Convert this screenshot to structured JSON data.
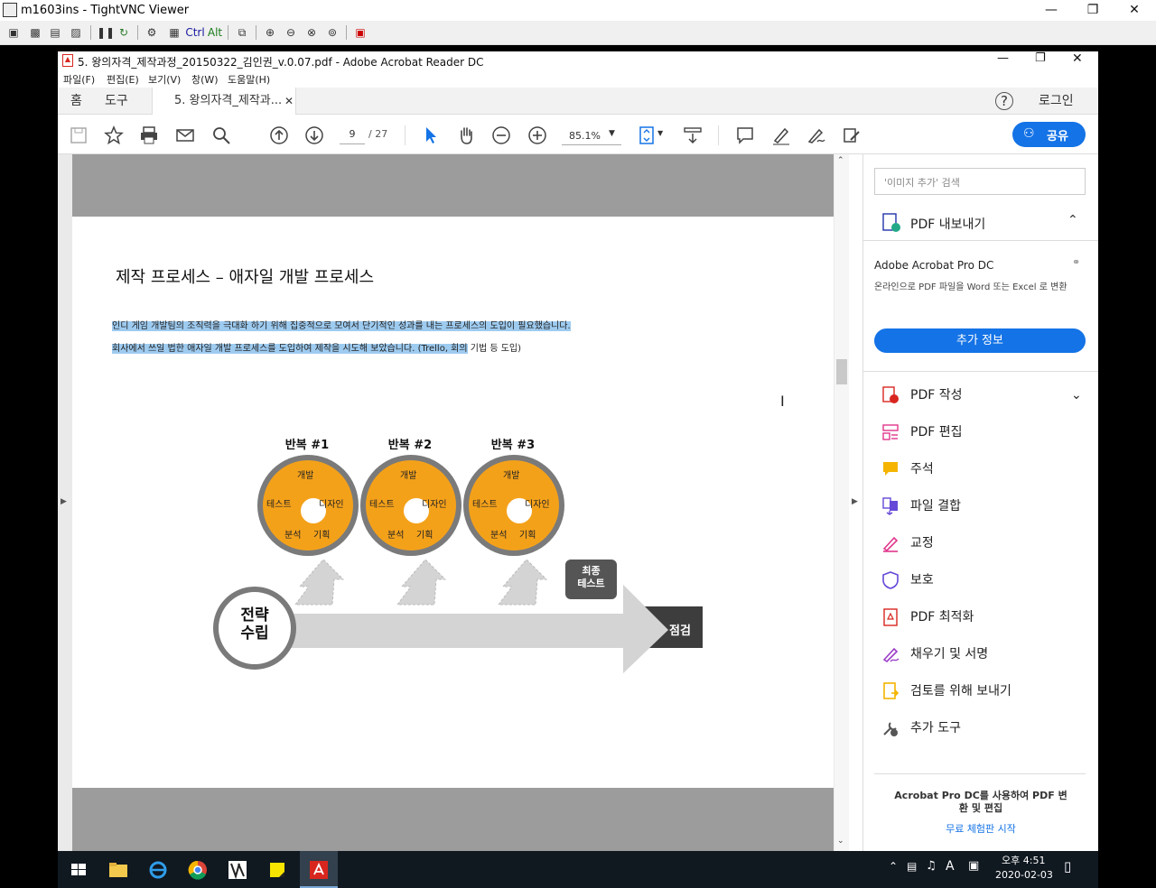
{
  "vnc": {
    "title": "m1603ins - TightVNC Viewer",
    "toolbar_ctrl": "Ctrl",
    "toolbar_alt": "Alt"
  },
  "acrobat": {
    "title": "5. 왕의자격_제작과정_20150322_김인권_v.0.07.pdf - Adobe Acrobat Reader DC",
    "menu": [
      "파일(F)",
      "편집(E)",
      "보기(V)",
      "창(W)",
      "도움말(H)"
    ],
    "tabs": {
      "home": "홈",
      "tools": "도구",
      "doc": "5. 왕의자격_제작과...",
      "login": "로그인"
    },
    "toolbar": {
      "page_current": "9",
      "page_total": "/ 27",
      "zoom": "85.1%",
      "share": "공유"
    }
  },
  "page": {
    "title": "제작 프로세스 – 애자일 개발 프로세스",
    "line1": "인디 게임 개발팀의 조직력을 극대화 하기 위해 집중적으로 모여서 단기적인 성과를 내는 프로세스의 도입이 필요했습니다.",
    "line2_hl": "회사에서 쓰일 법한 애자일 개발 프로세스를 도입하여 제작을 시도해 보았습니다. (Trello, 회의",
    "line2_rest": " 기법 등 도입)",
    "iterations": [
      {
        "title": "반복 #1"
      },
      {
        "title": "반복 #2"
      },
      {
        "title": "반복 #3"
      }
    ],
    "cycle_labels": {
      "top": "개발",
      "left": "테스트",
      "right": "디자인",
      "bl": "분석",
      "br": "기획"
    },
    "strategy": "전략\n수립",
    "final_test": "최종\n테스트",
    "check": "점검"
  },
  "sidebar": {
    "search_placeholder": "'이미지 추가' 검색",
    "export_header": "PDF 내보내기",
    "product": "Adobe Acrobat Pro DC",
    "desc": "온라인으로 PDF 파일을 Word 또는 Excel 로 변환",
    "more_info": "추가 정보",
    "items": [
      "PDF 작성",
      "PDF 편집",
      "주석",
      "파일 결합",
      "교정",
      "보호",
      "PDF 최적화",
      "채우기 및 서명",
      "검토를 위해 보내기",
      "추가 도구"
    ],
    "promo": "Acrobat Pro DC를 사용하여 PDF 변환 및 편집",
    "trial": "무료 체험판 시작"
  },
  "taskbar": {
    "time": "오후 4:51",
    "date": "2020-02-03",
    "ime": "A"
  },
  "colors": {
    "accent": "#1473e6",
    "orange": "#f4a11a",
    "pdf_red": "#d8261f"
  }
}
